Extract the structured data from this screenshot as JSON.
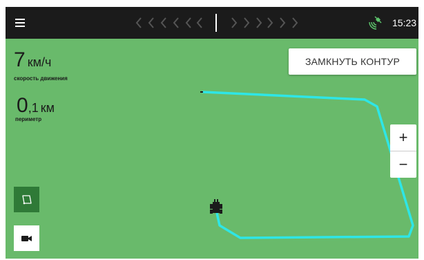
{
  "status_bar": {
    "time": "15:23",
    "icons": {
      "menu": "menu-icon",
      "satellite": "satellite-signal-icon"
    },
    "guidance": {
      "left": "chevrons-left-icon",
      "center": "guidance-center-line",
      "right": "chevrons-right-icon"
    }
  },
  "speed": {
    "value": "7",
    "unit": "км/ч",
    "label": "скорость движения"
  },
  "perimeter": {
    "value_int": "0",
    "value_dec": ",1",
    "unit": "км",
    "label": "периметр"
  },
  "close_contour_button": "ЗАМКНУТЬ КОНТУР",
  "zoom": {
    "in": "+",
    "out": "−"
  },
  "tools": {
    "layer_icon": "field-boundary-icon",
    "camera_icon": "video-camera-icon"
  },
  "colors": {
    "map_background": "#69ba6b",
    "track": "#2ee6e6",
    "top_bar": "#1b1b1b",
    "tool_active": "#2f7a37"
  }
}
